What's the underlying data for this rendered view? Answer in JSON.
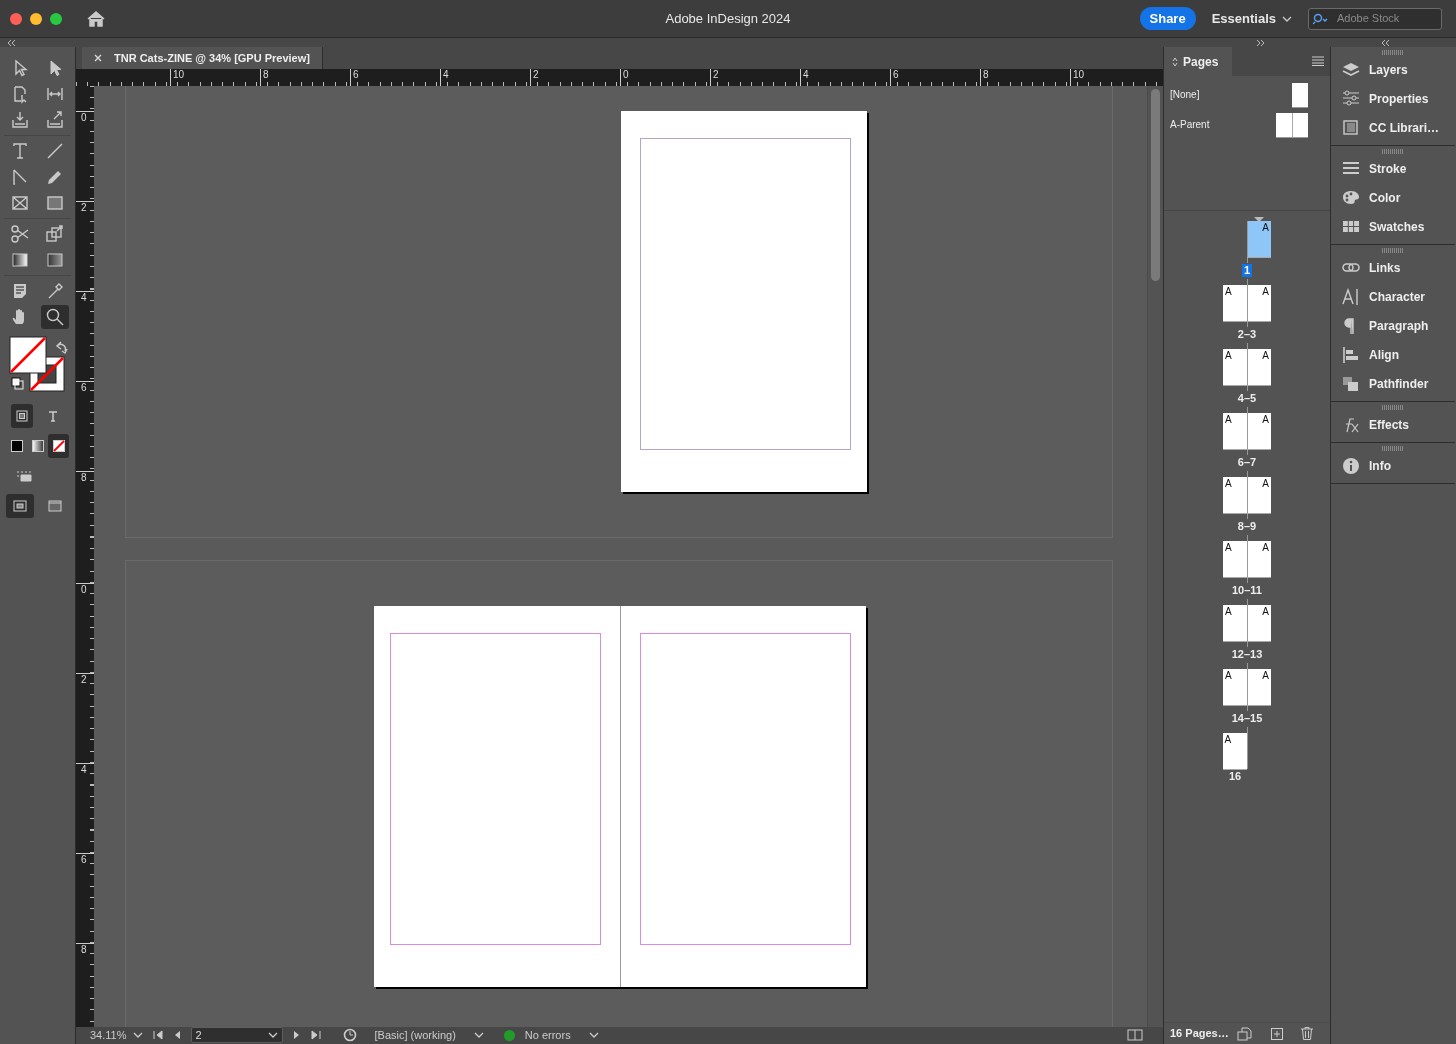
{
  "window": {
    "title": "Adobe InDesign 2024"
  },
  "header": {
    "share_button": "Share",
    "workspace": "Essentials",
    "search": {
      "placeholder": "Adobe Stock"
    }
  },
  "document_tab": {
    "title": "TNR Cats-ZINE @ 34% [GPU Preview]"
  },
  "rulers": {
    "horizontal": [
      "10",
      "8",
      "6",
      "4",
      "2",
      "0",
      "2",
      "4",
      "6",
      "8",
      "10"
    ],
    "vertical": [
      [
        "0",
        "2",
        "4",
        "6",
        "8"
      ],
      [
        "0",
        "2",
        "4",
        "6",
        "8"
      ]
    ]
  },
  "tools": [
    {
      "kind": "selection",
      "selected": false
    },
    {
      "kind": "direct-selection",
      "selected": false
    },
    {
      "kind": "page",
      "selected": false
    },
    {
      "kind": "gap",
      "selected": false
    },
    {
      "kind": "content-collector",
      "selected": false
    },
    {
      "kind": "content-placer",
      "selected": false
    },
    {
      "kind": "type",
      "selected": false
    },
    {
      "kind": "line",
      "selected": false
    },
    {
      "kind": "pen",
      "selected": false
    },
    {
      "kind": "pencil",
      "selected": false
    },
    {
      "kind": "rectangle-frame",
      "selected": false
    },
    {
      "kind": "rectangle",
      "selected": false
    },
    {
      "kind": "scissors",
      "selected": false
    },
    {
      "kind": "free-transform",
      "selected": false
    },
    {
      "kind": "gradient-swatch",
      "selected": false
    },
    {
      "kind": "gradient-feather",
      "selected": false
    },
    {
      "kind": "note",
      "selected": false
    },
    {
      "kind": "eyedropper",
      "selected": false
    },
    {
      "kind": "hand",
      "selected": false
    },
    {
      "kind": "zoom",
      "selected": true
    }
  ],
  "format_affects": [
    {
      "kind": "container",
      "selected": true
    },
    {
      "kind": "text",
      "selected": false
    }
  ],
  "apply": [
    {
      "kind": "color",
      "selected": false
    },
    {
      "kind": "gradient",
      "selected": false
    },
    {
      "kind": "none",
      "selected": true
    }
  ],
  "screen_modes": [
    {
      "kind": "normal",
      "selected": true
    },
    {
      "kind": "preview",
      "selected": false
    }
  ],
  "spreads": [
    {
      "kind": "single-right"
    },
    {
      "kind": "facing"
    }
  ],
  "pages_panel": {
    "title": "Pages",
    "parents": [
      {
        "label": "[None]",
        "kind": "single"
      },
      {
        "label": "A-Parent",
        "kind": "spread"
      }
    ],
    "pages": [
      {
        "label": "1",
        "kind": "right",
        "parents": [
          "A"
        ],
        "selected": true
      },
      {
        "label": "2–3",
        "kind": "spread",
        "parents": [
          "A",
          "A"
        ],
        "selected": false
      },
      {
        "label": "4–5",
        "kind": "spread",
        "parents": [
          "A",
          "A"
        ],
        "selected": false
      },
      {
        "label": "6–7",
        "kind": "spread",
        "parents": [
          "A",
          "A"
        ],
        "selected": false
      },
      {
        "label": "8–9",
        "kind": "spread",
        "parents": [
          "A",
          "A"
        ],
        "selected": false
      },
      {
        "label": "10–11",
        "kind": "spread",
        "parents": [
          "A",
          "A"
        ],
        "selected": false
      },
      {
        "label": "12–13",
        "kind": "spread",
        "parents": [
          "A",
          "A"
        ],
        "selected": false
      },
      {
        "label": "14–15",
        "kind": "spread",
        "parents": [
          "A",
          "A"
        ],
        "selected": false
      },
      {
        "label": "16",
        "kind": "left",
        "parents": [
          "A"
        ],
        "selected": false
      }
    ],
    "footer": "16 Pages…"
  },
  "dock": {
    "groups": [
      [
        {
          "label": "Layers",
          "kind": "layers"
        },
        {
          "label": "Properties",
          "kind": "properties"
        },
        {
          "label": "CC Librari…",
          "kind": "libraries"
        }
      ],
      [
        {
          "label": "Stroke",
          "kind": "stroke"
        },
        {
          "label": "Color",
          "kind": "color"
        },
        {
          "label": "Swatches",
          "kind": "swatches"
        }
      ],
      [
        {
          "label": "Links",
          "kind": "links"
        },
        {
          "label": "Character",
          "kind": "character"
        },
        {
          "label": "Paragraph",
          "kind": "paragraph"
        },
        {
          "label": "Align",
          "kind": "align"
        },
        {
          "label": "Pathfinder",
          "kind": "pathfinder"
        }
      ],
      [
        {
          "label": "Effects",
          "kind": "effects"
        }
      ],
      [
        {
          "label": "Info",
          "kind": "info"
        }
      ]
    ]
  },
  "status_bar": {
    "zoom": "34.11%",
    "page": "2",
    "preflight_profile": "[Basic] (working)",
    "preflight_status": "No errors"
  }
}
